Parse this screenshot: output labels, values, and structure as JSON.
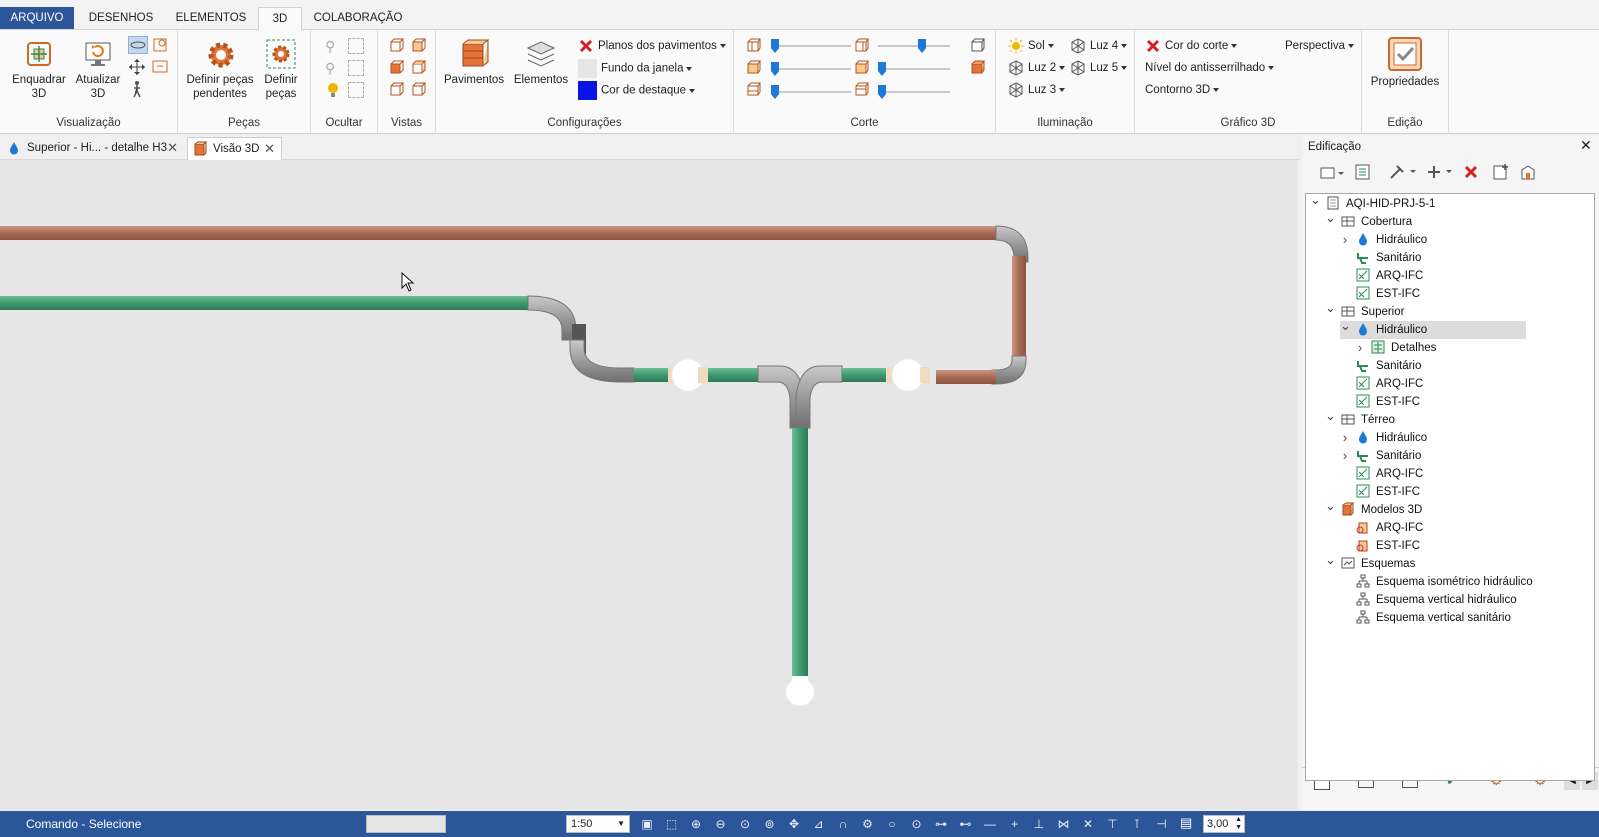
{
  "menu": {
    "tabs": [
      "ARQUIVO",
      "DESENHOS",
      "ELEMENTOS",
      "3D",
      "COLABORAÇÃO"
    ],
    "active": "3D"
  },
  "ribbon": {
    "visualizacao": {
      "label": "Visualização",
      "enquadrar": "Enquadrar 3D",
      "atualizar": "Atualizar 3D"
    },
    "pecas": {
      "label": "Peças",
      "definir_pendentes": "Definir peças pendentes",
      "definir": "Definir peças"
    },
    "ocultar": {
      "label": "Ocultar"
    },
    "vistas": {
      "label": "Vistas"
    },
    "configuracoes": {
      "label": "Configurações",
      "pavimentos": "Pavimentos",
      "elementos": "Elementos",
      "planos": "Planos dos pavimentos",
      "fundo": "Fundo da janela",
      "destaque": "Cor de destaque",
      "destaque_color": "#0a14e6"
    },
    "corte": {
      "label": "Corte"
    },
    "iluminacao": {
      "label": "Iluminação",
      "sol": "Sol",
      "luz2": "Luz 2",
      "luz3": "Luz 3",
      "luz4": "Luz 4",
      "luz5": "Luz 5"
    },
    "grafico": {
      "label": "Gráfico 3D",
      "cor_corte": "Cor do corte",
      "perspectiva": "Perspectiva",
      "antisserrilhado": "Nível do antisserrilhado",
      "contorno": "Contorno 3D"
    },
    "edicao": {
      "label": "Edição",
      "propriedades": "Propriedades"
    }
  },
  "doc_tabs": [
    {
      "label": "Superior - Hi... - detalhe H3",
      "icon": "water-drop-icon",
      "active": false
    },
    {
      "label": "Visão 3D",
      "icon": "building-icon",
      "active": true
    }
  ],
  "panel": {
    "title": "Edificação",
    "tree": [
      {
        "label": "AQI-HID-PRJ-5-1",
        "level": 0,
        "icon": "project",
        "exp": "open"
      },
      {
        "label": "Cobertura",
        "level": 1,
        "icon": "floor",
        "exp": "open"
      },
      {
        "label": "Hidráulico",
        "level": 2,
        "icon": "drop",
        "exp": "closed"
      },
      {
        "label": "Sanitário",
        "level": 2,
        "icon": "toilet",
        "exp": ""
      },
      {
        "label": "ARQ-IFC",
        "level": 2,
        "icon": "ifc",
        "exp": ""
      },
      {
        "label": "EST-IFC",
        "level": 2,
        "icon": "ifc",
        "exp": ""
      },
      {
        "label": "Superior",
        "level": 1,
        "icon": "floor",
        "exp": "open"
      },
      {
        "label": "Hidráulico",
        "level": 2,
        "icon": "drop",
        "exp": "open",
        "selected": true
      },
      {
        "label": "Detalhes",
        "level": 3,
        "icon": "details",
        "exp": "closed"
      },
      {
        "label": "Sanitário",
        "level": 2,
        "icon": "toilet",
        "exp": ""
      },
      {
        "label": "ARQ-IFC",
        "level": 2,
        "icon": "ifc",
        "exp": ""
      },
      {
        "label": "EST-IFC",
        "level": 2,
        "icon": "ifc",
        "exp": ""
      },
      {
        "label": "Térreo",
        "level": 1,
        "icon": "floor",
        "exp": "open"
      },
      {
        "label": "Hidráulico",
        "level": 2,
        "icon": "drop",
        "exp": "closed"
      },
      {
        "label": "Sanitário",
        "level": 2,
        "icon": "toilet",
        "exp": "closed"
      },
      {
        "label": "ARQ-IFC",
        "level": 2,
        "icon": "ifc",
        "exp": ""
      },
      {
        "label": "EST-IFC",
        "level": 2,
        "icon": "ifc",
        "exp": ""
      },
      {
        "label": "Modelos 3D",
        "level": 1,
        "icon": "model",
        "exp": "open"
      },
      {
        "label": "ARQ-IFC",
        "level": 2,
        "icon": "model3d",
        "exp": ""
      },
      {
        "label": "EST-IFC",
        "level": 2,
        "icon": "model3d",
        "exp": ""
      },
      {
        "label": "Esquemas",
        "level": 1,
        "icon": "schema",
        "exp": "open"
      },
      {
        "label": "Esquema isométrico hidráulico",
        "level": 2,
        "icon": "schemaitem",
        "exp": ""
      },
      {
        "label": "Esquema vertical hidráulico",
        "level": 2,
        "icon": "schemaitem",
        "exp": ""
      },
      {
        "label": "Esquema vertical sanitário",
        "level": 2,
        "icon": "schemaitem",
        "exp": ""
      }
    ]
  },
  "status": {
    "command": "Comando - Selecione",
    "scale": "1:50",
    "value": "3,00"
  },
  "colors": {
    "pipe_green": "#3f9a6e",
    "pipe_copper": "#b07a64",
    "fitting_gray": "#8a8a8a",
    "accent": "#2b579a"
  }
}
